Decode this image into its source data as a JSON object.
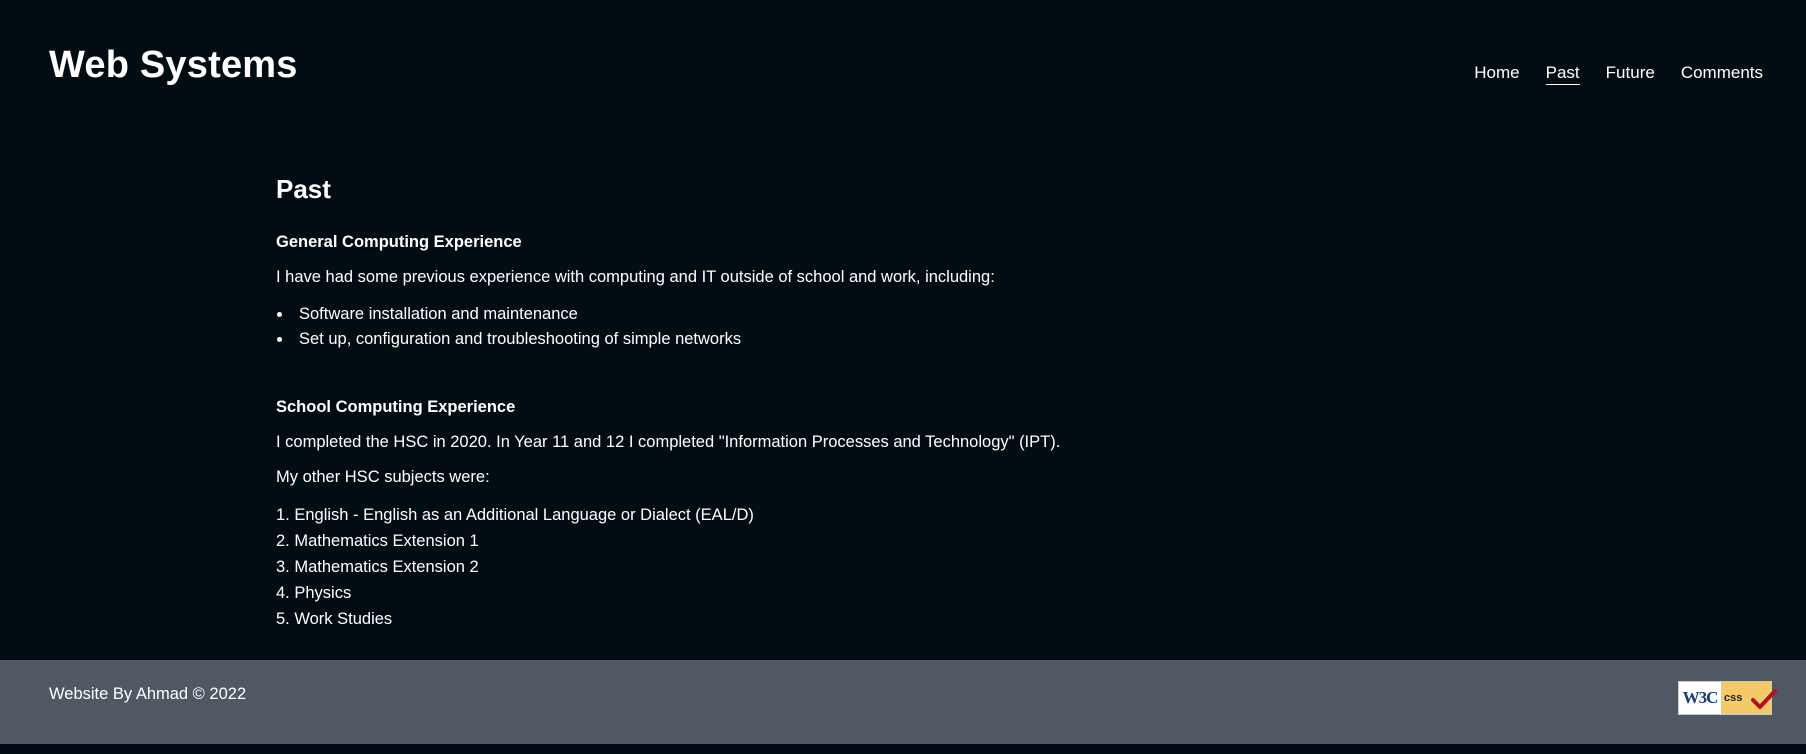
{
  "header": {
    "site_title": "Web Systems",
    "nav": [
      "Home",
      "Past",
      "Future",
      "Comments"
    ],
    "active_nav": "Past"
  },
  "main": {
    "page_heading": "Past",
    "general": {
      "heading": "General Computing Experience",
      "intro": "I have had some previous experience with computing and IT outside of school and work, including:",
      "items": [
        "Software installation and maintenance",
        "Set up, configuration and troubleshooting of simple networks"
      ]
    },
    "school": {
      "heading": "School Computing Experience",
      "para1": "I completed the HSC in 2020. In Year 11 and 12 I completed \"Information Processes and Technology\" (IPT).",
      "para2": "My other HSC subjects were:",
      "subjects": [
        "1. English - English as an Additional Language or Dialect (EAL/D)",
        "2. Mathematics Extension 1",
        "3. Mathematics Extension 2",
        "4. Physics",
        "5. Work Studies"
      ]
    }
  },
  "footer": {
    "text": "Website By Ahmad © 2022",
    "badge_left": "W3C",
    "badge_right": "css"
  },
  "colors": {
    "background": "#020d13",
    "footer_background": "#4f5863",
    "text": "#ffffff",
    "badge_accent": "#f4c96a"
  }
}
